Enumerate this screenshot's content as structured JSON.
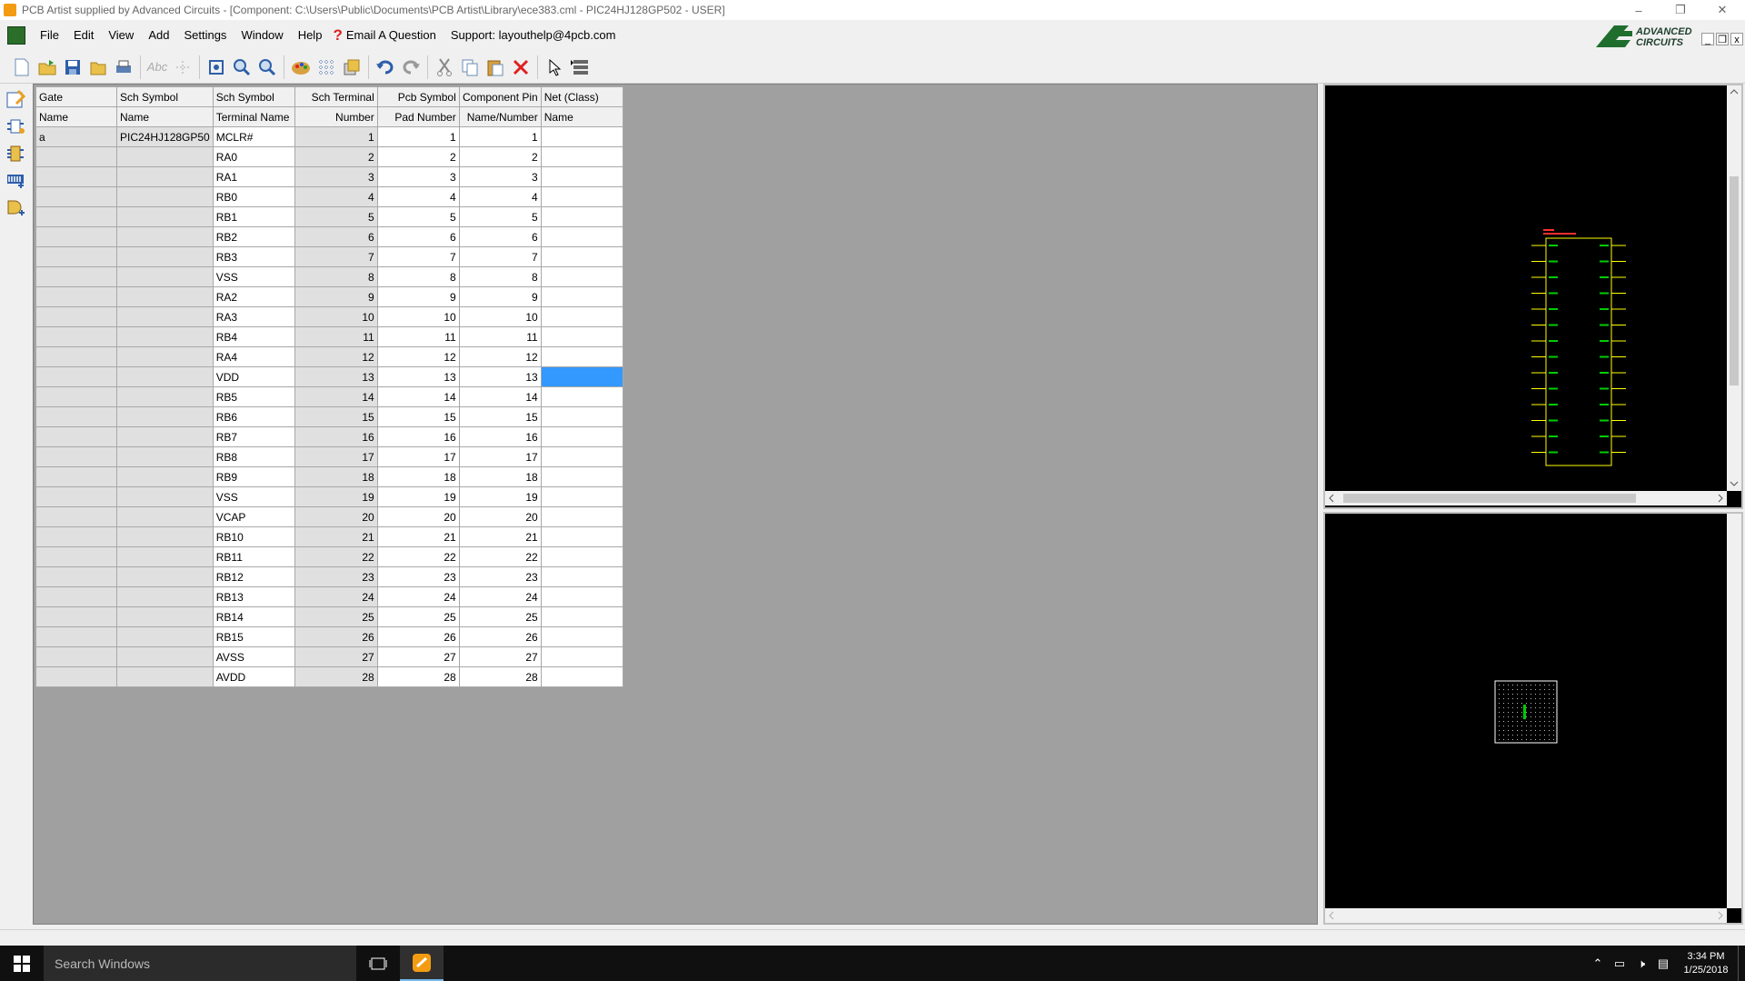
{
  "window": {
    "title": "PCB Artist supplied by Advanced Circuits - [Component: C:\\Users\\Public\\Documents\\PCB Artist\\Library\\ece383.cml - PIC24HJ128GP502 - USER]",
    "minimize": "–",
    "restore": "❐",
    "close": "✕"
  },
  "menu": {
    "items": [
      "File",
      "Edit",
      "View",
      "Add",
      "Settings",
      "Window",
      "Help"
    ],
    "email": "Email A Question",
    "support": "Support: layouthelp@4pcb.com"
  },
  "logo": {
    "line1": "ADVANCED",
    "line2": "CIRCUITS"
  },
  "mdi": {
    "minimize": "_",
    "restore": "❐",
    "close": "x"
  },
  "grid": {
    "headers_top": [
      "Gate",
      "Sch Symbol",
      "Sch Symbol",
      "Sch Terminal",
      "Pcb Symbol",
      "Component Pin",
      "Net (Class)"
    ],
    "headers_bottom": [
      "Name",
      "Name",
      "Terminal Name",
      "Number",
      "Pad Number",
      "Name/Number",
      "Name"
    ],
    "gate_value": "a",
    "symbol_value": "PIC24HJ128GP50",
    "rows": [
      [
        "MCLR#",
        "1",
        "1",
        "1"
      ],
      [
        "RA0",
        "2",
        "2",
        "2"
      ],
      [
        "RA1",
        "3",
        "3",
        "3"
      ],
      [
        "RB0",
        "4",
        "4",
        "4"
      ],
      [
        "RB1",
        "5",
        "5",
        "5"
      ],
      [
        "RB2",
        "6",
        "6",
        "6"
      ],
      [
        "RB3",
        "7",
        "7",
        "7"
      ],
      [
        "VSS",
        "8",
        "8",
        "8"
      ],
      [
        "RA2",
        "9",
        "9",
        "9"
      ],
      [
        "RA3",
        "10",
        "10",
        "10"
      ],
      [
        "RB4",
        "11",
        "11",
        "11"
      ],
      [
        "RA4",
        "12",
        "12",
        "12"
      ],
      [
        "VDD",
        "13",
        "13",
        "13"
      ],
      [
        "RB5",
        "14",
        "14",
        "14"
      ],
      [
        "RB6",
        "15",
        "15",
        "15"
      ],
      [
        "RB7",
        "16",
        "16",
        "16"
      ],
      [
        "RB8",
        "17",
        "17",
        "17"
      ],
      [
        "RB9",
        "18",
        "18",
        "18"
      ],
      [
        "VSS",
        "19",
        "19",
        "19"
      ],
      [
        "VCAP",
        "20",
        "20",
        "20"
      ],
      [
        "RB10",
        "21",
        "21",
        "21"
      ],
      [
        "RB11",
        "22",
        "22",
        "22"
      ],
      [
        "RB12",
        "23",
        "23",
        "23"
      ],
      [
        "RB13",
        "24",
        "24",
        "24"
      ],
      [
        "RB14",
        "25",
        "25",
        "25"
      ],
      [
        "RB15",
        "26",
        "26",
        "26"
      ],
      [
        "AVSS",
        "27",
        "27",
        "27"
      ],
      [
        "AVDD",
        "28",
        "28",
        "28"
      ]
    ],
    "selected_row": 12
  },
  "taskbar": {
    "search_placeholder": "Search Windows",
    "time": "3:34 PM",
    "date": "1/25/2018"
  },
  "colors": {
    "selection": "#3399ff",
    "schematic_outline": "#ffff00",
    "schematic_pins": "#00cc00",
    "schematic_label": "#ff3030"
  }
}
